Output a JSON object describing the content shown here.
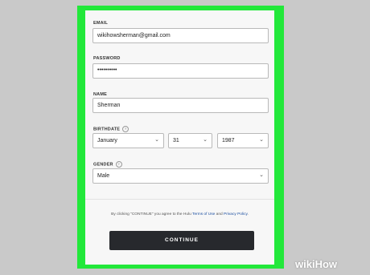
{
  "form": {
    "email_label": "EMAIL",
    "email_value": "wikihowsherman@gmail.com",
    "password_label": "PASSWORD",
    "password_value": "••••••••••",
    "name_label": "NAME",
    "name_value": "Sherman",
    "birthdate_label": "BIRTHDATE",
    "birth_month": "January",
    "birth_day": "31",
    "birth_year": "1987",
    "gender_label": "GENDER",
    "gender_value": "Male",
    "help_glyph": "?",
    "chevron_glyph": "⌄"
  },
  "terms": {
    "prefix": "By clicking \"CONTINUE\" you agree to the Hulu",
    "terms_link": "Terms of Use",
    "and": "and",
    "privacy_link": "Privacy Policy",
    "suffix": "."
  },
  "continue_label": "CONTINUE",
  "watermark": {
    "wiki": "wiki",
    "how": "How"
  },
  "colors": {
    "frame": "#22e83a",
    "button": "#27292d",
    "link": "#1c4fa0"
  }
}
